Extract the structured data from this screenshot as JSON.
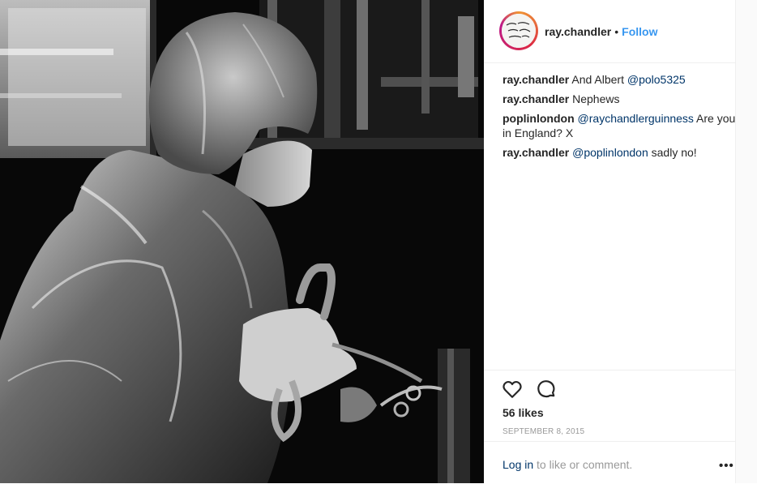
{
  "post": {
    "photo_icon": "photo",
    "header": {
      "username": "ray.chandler",
      "separator": "•",
      "follow_label": "Follow",
      "avatar_icon": "profile-avatar"
    },
    "comments": [
      {
        "user": "ray.chandler",
        "mention": "",
        "text": "And Albert ",
        "mention_after": "@polo5325"
      },
      {
        "user": "ray.chandler",
        "mention": "",
        "text": "Nephews",
        "mention_after": ""
      },
      {
        "user": "poplinlondon",
        "mention": "@raychandlerguinness",
        "text": " Are you in England? X",
        "mention_after": ""
      },
      {
        "user": "ray.chandler",
        "mention": "@poplinlondon",
        "text": " sadly no!",
        "mention_after": ""
      }
    ],
    "actions": {
      "like_icon": "heart-icon",
      "comment_icon": "comment-icon"
    },
    "likes": "56 likes",
    "date": "SEPTEMBER 8, 2015",
    "footer": {
      "login_label": "Log in",
      "login_suffix": " to like or comment.",
      "more_label": "•••",
      "more_icon": "more-options-icon"
    },
    "colors": {
      "follow": "#3897f0",
      "link": "#003569",
      "muted": "#999999",
      "text": "#262626"
    }
  }
}
